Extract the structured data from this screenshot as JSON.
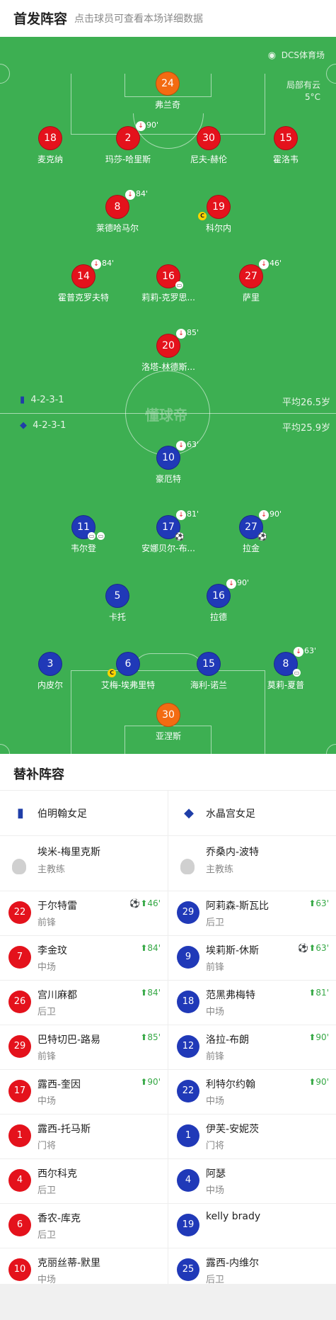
{
  "header": {
    "title": "首发阵容",
    "subtitle": "点击球员可查看本场详细数据"
  },
  "pitch": {
    "venue": "DCS体育场",
    "weather": "局部有云",
    "temperature": "5°C",
    "watermark": "懂球帝"
  },
  "home_team": {
    "name": "伯明翰女足",
    "formation": "4-2-3-1",
    "avg_age": "平均26.5岁"
  },
  "away_team": {
    "name": "水晶宫女足",
    "formation": "4-2-3-1",
    "avg_age": "平均25.9岁"
  },
  "home_players": [
    {
      "number": "24",
      "name": "弗兰奇"
    },
    {
      "number": "18",
      "name": "麦克纳"
    },
    {
      "number": "2",
      "name": "玛莎-哈里斯",
      "sub": "90'"
    },
    {
      "number": "30",
      "name": "尼夫-赫伦"
    },
    {
      "number": "15",
      "name": "霍洛韦"
    },
    {
      "number": "8",
      "name": "莱德哈马尔",
      "sub": "84'"
    },
    {
      "number": "19",
      "name": "科尔内",
      "captain": "C"
    },
    {
      "number": "14",
      "name": "霍普克罗夫特",
      "sub": "84'"
    },
    {
      "number": "16",
      "name": "莉莉-克罗思..."
    },
    {
      "number": "27",
      "name": "萨里",
      "sub": "46'"
    },
    {
      "number": "20",
      "name": "洛塔-林德斯...",
      "sub": "85'"
    }
  ],
  "away_players": [
    {
      "number": "10",
      "name": "豪厄特",
      "sub": "63'"
    },
    {
      "number": "11",
      "name": "韦尔登"
    },
    {
      "number": "17",
      "name": "安娜贝尔-布...",
      "sub": "81'"
    },
    {
      "number": "27",
      "name": "拉金",
      "sub": "90'"
    },
    {
      "number": "5",
      "name": "卡托"
    },
    {
      "number": "16",
      "name": "拉德",
      "sub": "90'"
    },
    {
      "number": "3",
      "name": "内皮尔"
    },
    {
      "number": "6",
      "name": "艾梅-埃弗里特",
      "captain": "C"
    },
    {
      "number": "15",
      "name": "海利-诺兰"
    },
    {
      "number": "8",
      "name": "莫莉-夏普",
      "sub": "63'"
    },
    {
      "number": "30",
      "name": "亚涅斯"
    }
  ],
  "subs": {
    "title": "替补阵容",
    "home": {
      "team": "伯明翰女足",
      "coach": {
        "name": "埃米-梅里克斯",
        "role": "主教练"
      },
      "players": [
        {
          "number": "22",
          "name": "于尔特雷",
          "position": "前锋",
          "event": "46'",
          "goal": "⚽"
        },
        {
          "number": "7",
          "name": "李金玟",
          "position": "中场",
          "event": "84'"
        },
        {
          "number": "26",
          "name": "宫川麻都",
          "position": "后卫",
          "event": "84'"
        },
        {
          "number": "29",
          "name": "巴特切巴-路易",
          "position": "前锋",
          "event": "85'"
        },
        {
          "number": "17",
          "name": "露西-奎因",
          "position": "中场",
          "event": "90'"
        },
        {
          "number": "1",
          "name": "露西-托马斯",
          "position": "门将"
        },
        {
          "number": "4",
          "name": "西尔科克",
          "position": "后卫"
        },
        {
          "number": "6",
          "name": "香农-库克",
          "position": "后卫"
        },
        {
          "number": "10",
          "name": "克丽丝蒂-默里",
          "position": "中场"
        }
      ]
    },
    "away": {
      "team": "水晶宫女足",
      "coach": {
        "name": "乔桑内-波特",
        "role": "主教练"
      },
      "players": [
        {
          "number": "29",
          "name": "阿莉森-斯瓦比",
          "position": "后卫",
          "event": "63'"
        },
        {
          "number": "9",
          "name": "埃莉斯-休斯",
          "position": "前锋",
          "event": "63'",
          "goal": "⚽"
        },
        {
          "number": "18",
          "name": "范黑弗梅特",
          "position": "中场",
          "event": "81'"
        },
        {
          "number": "12",
          "name": "洛拉-布朗",
          "position": "前锋",
          "event": "90'"
        },
        {
          "number": "22",
          "name": "利特尔约翰",
          "position": "中场",
          "event": "90'"
        },
        {
          "number": "1",
          "name": "伊芙-安妮茨",
          "position": "门将"
        },
        {
          "number": "4",
          "name": "阿瑟",
          "position": "中场"
        },
        {
          "number": "19",
          "name": "kelly brady",
          "position": ""
        },
        {
          "number": "25",
          "name": "露西-内维尔",
          "position": "后卫"
        }
      ]
    }
  },
  "colors": {
    "pitch": "#3daf52",
    "home": "#e4121c",
    "away": "#2039b8",
    "goalkeeper": "#f36b12",
    "sub_in": "#35a845"
  }
}
